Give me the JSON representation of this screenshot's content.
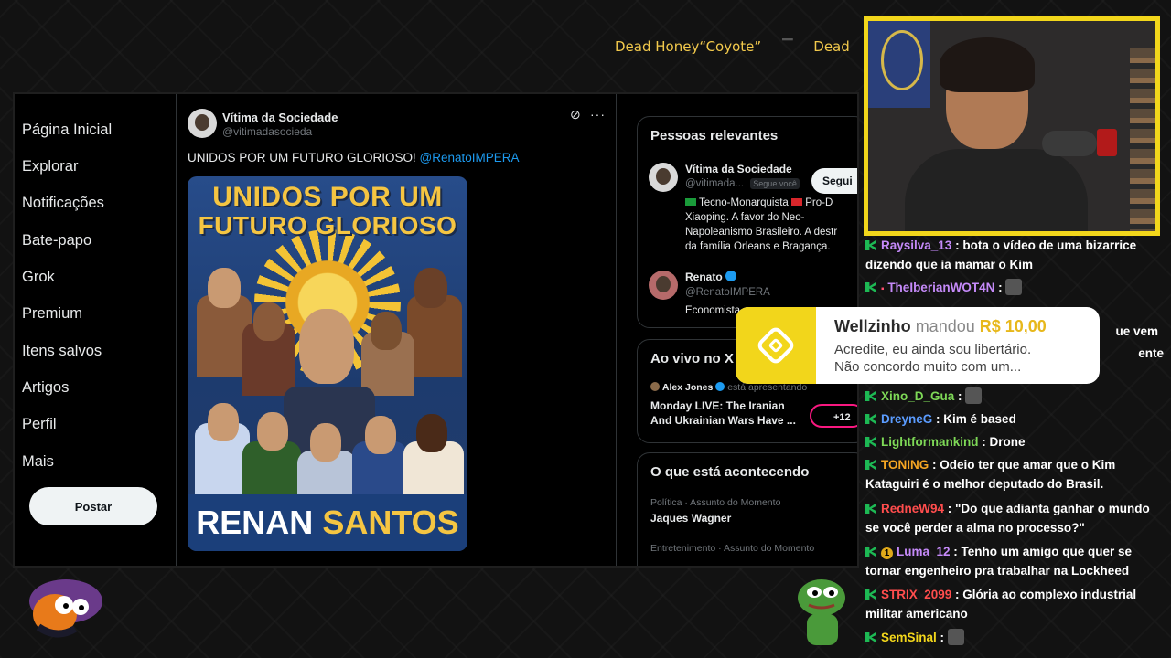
{
  "marquee": {
    "parts": [
      "Dead Honey",
      "“Coyote”",
      "Dead Honey"
    ]
  },
  "sidebar": {
    "items": [
      "Página Inicial",
      "Explorar",
      "Notificações",
      "Bate-papo",
      "Grok",
      "Premium",
      "Itens salvos",
      "Artigos",
      "Perfil",
      "Mais"
    ],
    "post_label": "Postar"
  },
  "tweet": {
    "author_name": "Vítima da Sociedade",
    "author_handle": "@vitimadasocieda",
    "text": "UNIDOS POR UM FUTURO GLORIOSO!",
    "mention": "@RenatoIMPERA",
    "poster": {
      "title_line1": "UNIDOS POR UM",
      "title_line2": "FUTURO GLORIOSO",
      "footer_first": "RENAN",
      "footer_last": "SANTOS"
    }
  },
  "relevant": {
    "title": "Pessoas relevantes",
    "follow_label": "Segui",
    "people": [
      {
        "name": "Vítima da Sociedade",
        "handle": "@vitimada...",
        "tag": "Segue você",
        "bio_line1": "Tecno-Monarquista",
        "bio_line1b": "Pro-D",
        "bio_line2": "Xiaoping. A favor do Neo-",
        "bio_line3": "Napoleanismo Brasileiro. A destr",
        "bio_line4": "da família Orleans e Bragança."
      },
      {
        "name": "Renato",
        "handle": "@RenatoIMPERA",
        "bio_line1": "Economista"
      }
    ]
  },
  "live": {
    "title": "Ao vivo no X",
    "host": "Alex Jones",
    "presenting": "está apresentando",
    "show_line1": "Monday LIVE: The Iranian",
    "show_line2": "And Ukrainian Wars Have ...",
    "count": "+12"
  },
  "happening": {
    "title": "O que está acontecendo",
    "items": [
      {
        "meta": "Política · Assunto do Momento",
        "topic": "Jaques Wagner"
      },
      {
        "meta": "Entretenimento · Assunto do Momento",
        "topic": ""
      }
    ]
  },
  "alert": {
    "name": "Wellzinho",
    "verb": "mandou",
    "amount": "R$ 10,00",
    "message_line1": "Acredite, eu ainda sou libertário.",
    "message_line2": "Não concordo muito com um..."
  },
  "chat": [
    {
      "user": "Raysilva_13",
      "color": "#c58af9",
      "line1": "bota o vídeo de uma bizarrice",
      "line2": "dizendo que ia mamar o Kim"
    },
    {
      "user": "TheIberianWOT4N",
      "color": "#c58af9",
      "line1": "",
      "line2": ""
    },
    {
      "user": "Xino_D_Gua",
      "color": "#7ed957",
      "line1": "",
      "line2": ""
    },
    {
      "user": "DreyneG",
      "color": "#5b9cff",
      "line1": "Kim é based",
      "line2": ""
    },
    {
      "user": "Lightformankind",
      "color": "#7ed957",
      "line1": "Drone",
      "line2": ""
    },
    {
      "user": "TONING",
      "color": "#f5a623",
      "line1": "Odeio ter que amar que o Kim",
      "line2": "Kataguiri é o melhor deputado do Brasil."
    },
    {
      "user": "RedneW94",
      "color": "#ff4d4d",
      "line1": "\"Do que adianta ganhar o mundo",
      "line2": "se você perder a alma no processo?\""
    },
    {
      "user": "Luma_12",
      "color": "#c58af9",
      "line1": "Tenho um amigo que quer se",
      "line2": "tornar engenheiro pra trabalhar na Lockheed"
    },
    {
      "user": "STRIX_2099",
      "color": "#ff4d4d",
      "line1": "Glória ao complexo industrial",
      "line2": "militar americano"
    },
    {
      "user": "SemSinal",
      "color": "#f2d61b",
      "line1": "",
      "line2": ""
    }
  ],
  "chat_partial": {
    "right1": "ue vem",
    "right2": "ente"
  },
  "colors": {
    "accent_yellow": "#f2d61b",
    "x_blue": "#1d9bf0"
  }
}
